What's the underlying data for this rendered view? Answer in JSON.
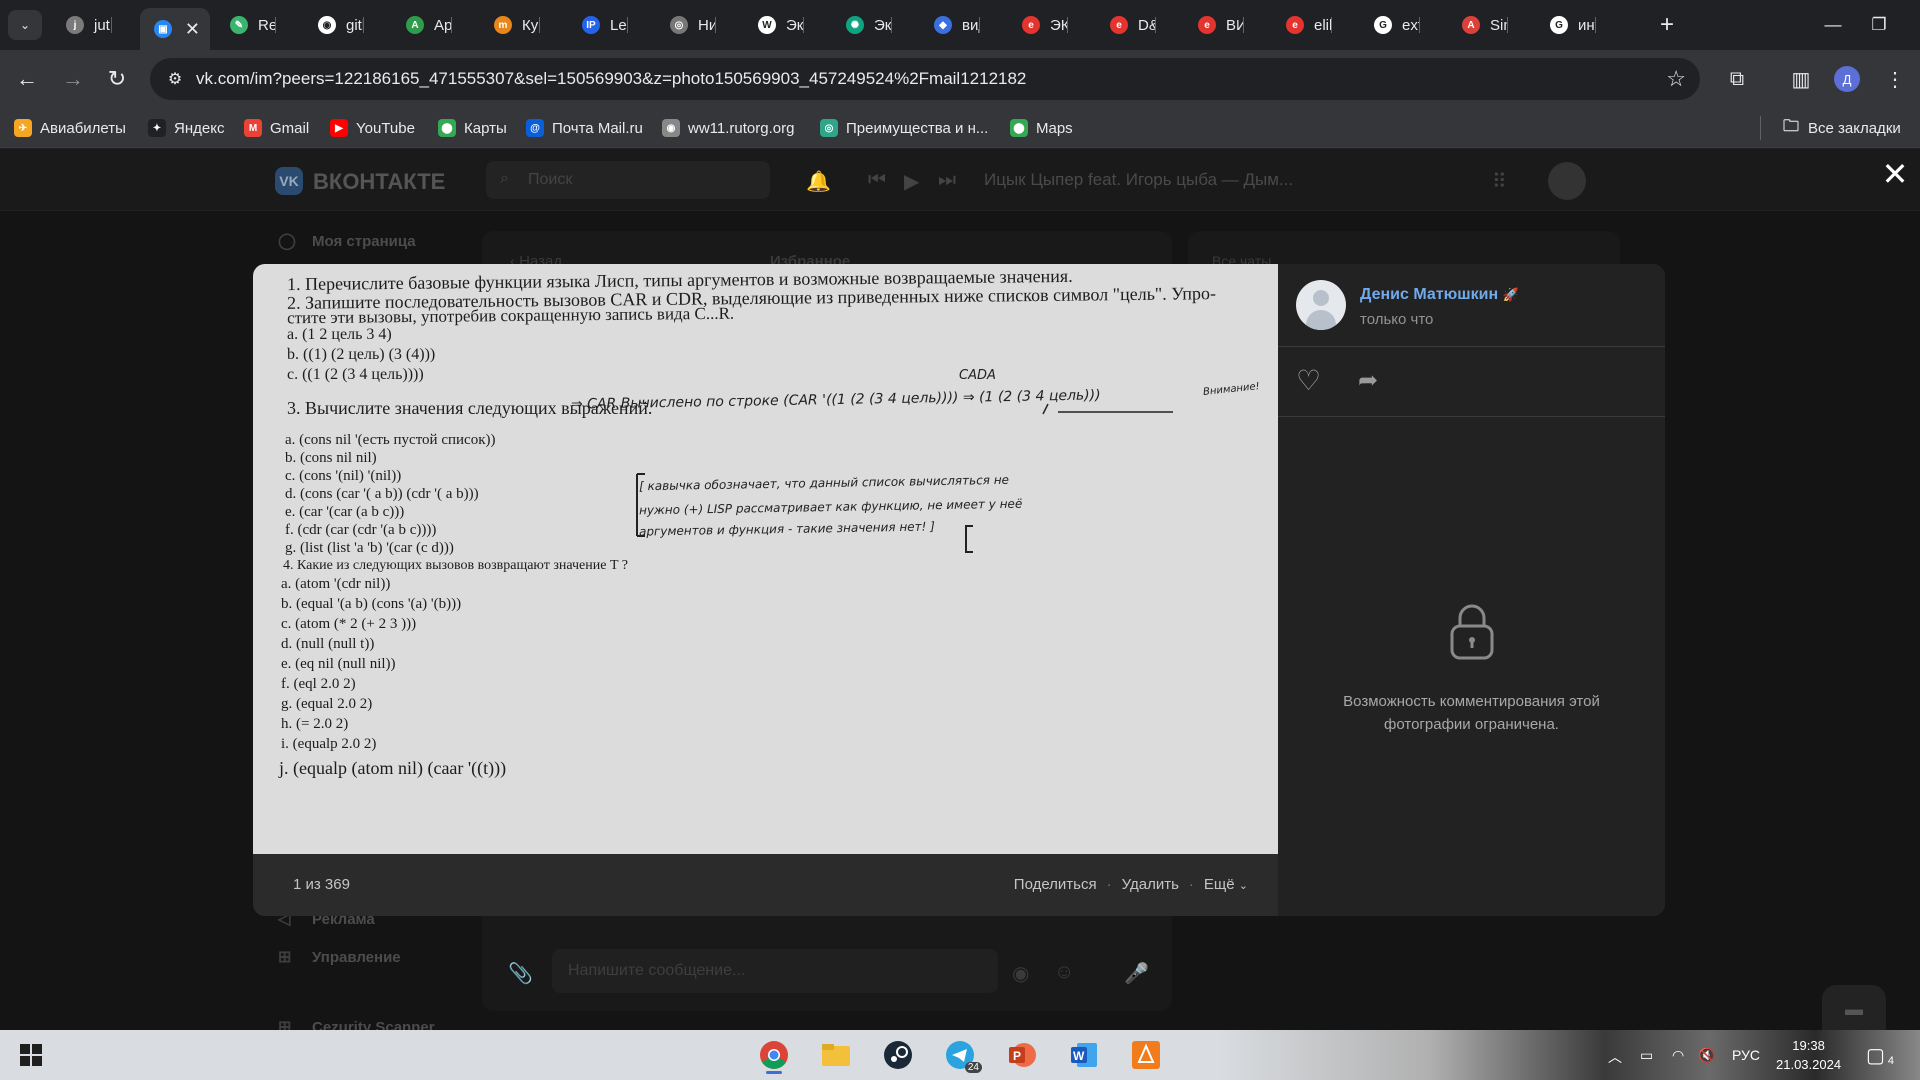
{
  "browser": {
    "tabs": [
      {
        "label": "jut.su",
        "color": "#7a7a7a",
        "glyph": "j"
      },
      {
        "label": "",
        "color": "#2787f5",
        "glyph": "▣",
        "active": true
      },
      {
        "label": "Repl",
        "color": "#3bb46e",
        "glyph": "✎"
      },
      {
        "label": "githu",
        "color": "#ffffff",
        "glyph": "◉"
      },
      {
        "label": "Арас",
        "color": "#2e9c4a",
        "glyph": "A"
      },
      {
        "label": "Курс",
        "color": "#e9861b",
        "glyph": "m"
      },
      {
        "label": "Lectu",
        "color": "#2563eb",
        "glyph": "IP"
      },
      {
        "label": "НиО",
        "color": "#777777",
        "glyph": "◎"
      },
      {
        "label": "Экст",
        "color": "#ffffff",
        "glyph": "W"
      },
      {
        "label": "Экст",
        "color": "#10a37f",
        "glyph": "✺"
      },
      {
        "label": "видь",
        "color": "#3b6fe0",
        "glyph": "◆"
      },
      {
        "label": "ЭКС",
        "color": "#e3342f",
        "glyph": "e"
      },
      {
        "label": "D&P",
        "color": "#e3342f",
        "glyph": "e"
      },
      {
        "label": "ВИД",
        "color": "#e3342f",
        "glyph": "e"
      },
      {
        "label": "elibr",
        "color": "#e3342f",
        "glyph": "e"
      },
      {
        "label": "extre",
        "color": "#ffffff",
        "glyph": "G"
      },
      {
        "label": "Simp",
        "color": "#d9413a",
        "glyph": "A"
      },
      {
        "label": "инте",
        "color": "#ffffff",
        "glyph": "G"
      }
    ],
    "new_tab": "+",
    "url": "vk.com/im?peers=122186165_471555307&sel=150569903&z=photo150569903_457249524%2Fmail1212182",
    "profile_initial": "Д",
    "bookmarks": [
      {
        "label": "Авиабилеты",
        "color": "#f5a623",
        "glyph": "✈"
      },
      {
        "label": "Яндекс",
        "color": "#202124",
        "glyph": "✦"
      },
      {
        "label": "Gmail",
        "color": "#ea4335",
        "glyph": "M"
      },
      {
        "label": "YouTube",
        "color": "#ff0000",
        "glyph": "▶"
      },
      {
        "label": "Карты",
        "color": "#34a853",
        "glyph": "⬤"
      },
      {
        "label": "Почта Mail.ru",
        "color": "#0a5fd8",
        "glyph": "@"
      },
      {
        "label": "ww11.rutorg.org",
        "color": "#888888",
        "glyph": "◉"
      },
      {
        "label": "Преимущества и н...",
        "color": "#2fa58a",
        "glyph": "◎"
      },
      {
        "label": "Maps",
        "color": "#34a853",
        "glyph": "⬤"
      }
    ],
    "all_bookmarks": "Все закладки"
  },
  "vk": {
    "brand": "ВКОНТАКТЕ",
    "search_placeholder": "Поиск",
    "now_playing": "Ицык Цыпер feat. Игорь цыба — Дым...",
    "side_items": [
      {
        "label": "Моя страница",
        "icon": "user-icon"
      },
      {
        "label": "Реклама",
        "icon": "megaphone-icon"
      },
      {
        "label": "Управление",
        "icon": "grid-icon"
      },
      {
        "label": "Cezurity Scanner",
        "icon": "shield-icon"
      }
    ],
    "chat_header": {
      "back": "Назад",
      "title": "Избранное"
    },
    "right_panel_label": "Все чаты",
    "compose_placeholder": "Напишите сообщение..."
  },
  "viewer": {
    "counter": "1 из 369",
    "actions": [
      "Поделиться",
      "Удалить",
      "Ещё"
    ],
    "author": "Денис Матюшкин",
    "time": "только что",
    "restricted": "Возможность комментирования этой фотографии ограничена."
  },
  "photo": {
    "lines": [
      "1. Перечислите базовые функции языка Лисп, типы аргументов и возможные возвращаемые значения.",
      "2. Запишите последовательность вызовов  CAR и CDR, выделяющие из приведенных ниже списков символ \"цель\". Упро-",
      "стите эти вызовы, употребив сокращенную запись вида C...R.",
      "a.      (1 2 цель 3 4)",
      "b.      ((1) (2 цель) (3 (4)))",
      "c.      ((1 (2  (3 4 цель))))",
      "3. Вычислите значения следующих выражений.",
      "a.        (cons nil '(есть пустой список))",
      "b.        (cons nil nil)",
      "c.        (cons '(nil) '(nil))",
      "d.        (cons (car '( a b)) (cdr '( a b)))",
      "e.        (car '(car (a b c)))",
      "f.        (cdr (car (cdr '(a b c))))",
      "g.        (list (list 'a 'b) '(car (c d)))",
      "4. Какие из следующих вызовов возвращают значение T ?",
      "a.        (atom '(cdr nil))",
      "b.        (equal '(a b) (cons '(a) '(b)))",
      "c.        (atom (* 2 (+ 2 3 )))",
      "d.        (null (null t))",
      "e.        (eq nil (null nil))",
      "f.        (eql 2.0 2)",
      "g.        (equal 2.0 2)",
      "h.        (= 2.0 2)",
      "i.        (equalp 2.0 2)",
      "j.      (equalp (atom nil) (caar '((t)))"
    ],
    "handwriting": [
      "CADA",
      "⇒  CAR  Вычислено по строке  (CAR '((1 (2 (3 4 цель)))) ⇒ (1 (2 (3 4 цель)))",
      "Внимание!",
      "[ кавычка обозначает, что данный список вычисляться не",
      "  нужно   (+) LISP рассматривает как функцию, не имеет у неё",
      "  аргументов и функция - такие значения нет! ]"
    ]
  },
  "taskbar": {
    "language": "РУС",
    "time": "19:38",
    "date": "21.03.2024",
    "notifications": "4",
    "telegram_badge": "24"
  }
}
